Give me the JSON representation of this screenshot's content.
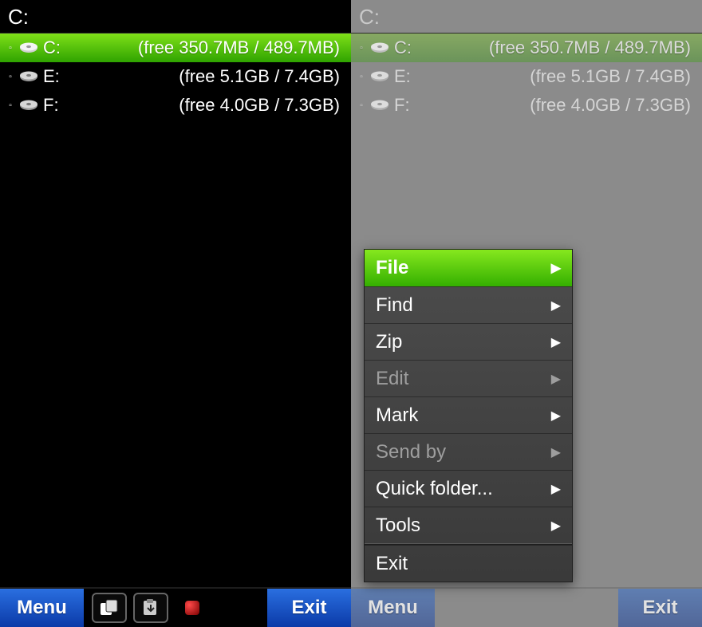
{
  "left": {
    "path": "C:",
    "drives": [
      {
        "letter": "C:",
        "info": "(free 350.7MB / 489.7MB)",
        "selected": true
      },
      {
        "letter": "E:",
        "info": "(free 5.1GB / 7.4GB)",
        "selected": false
      },
      {
        "letter": "F:",
        "info": "(free 4.0GB / 7.3GB)",
        "selected": false
      }
    ],
    "softkeys": {
      "left": "Menu",
      "right": "Exit"
    }
  },
  "right": {
    "path": "C:",
    "drives": [
      {
        "letter": "C:",
        "info": "(free 350.7MB / 489.7MB)",
        "selected": true
      },
      {
        "letter": "E:",
        "info": "(free 5.1GB / 7.4GB)",
        "selected": false
      },
      {
        "letter": "F:",
        "info": "(free 4.0GB / 7.3GB)",
        "selected": false
      }
    ],
    "softkeys": {
      "left": "Menu",
      "right": "Exit"
    },
    "menu": [
      {
        "label": "File",
        "arrow": true,
        "disabled": false,
        "selected": true
      },
      {
        "label": "Find",
        "arrow": true,
        "disabled": false,
        "selected": false
      },
      {
        "label": "Zip",
        "arrow": true,
        "disabled": false,
        "selected": false
      },
      {
        "label": "Edit",
        "arrow": true,
        "disabled": true,
        "selected": false
      },
      {
        "label": "Mark",
        "arrow": true,
        "disabled": false,
        "selected": false
      },
      {
        "label": "Send by",
        "arrow": true,
        "disabled": true,
        "selected": false
      },
      {
        "label": "Quick folder...",
        "arrow": true,
        "disabled": false,
        "selected": false
      },
      {
        "label": "Tools",
        "arrow": true,
        "disabled": false,
        "selected": false
      },
      {
        "label": "Exit",
        "arrow": false,
        "disabled": false,
        "selected": false
      }
    ]
  }
}
